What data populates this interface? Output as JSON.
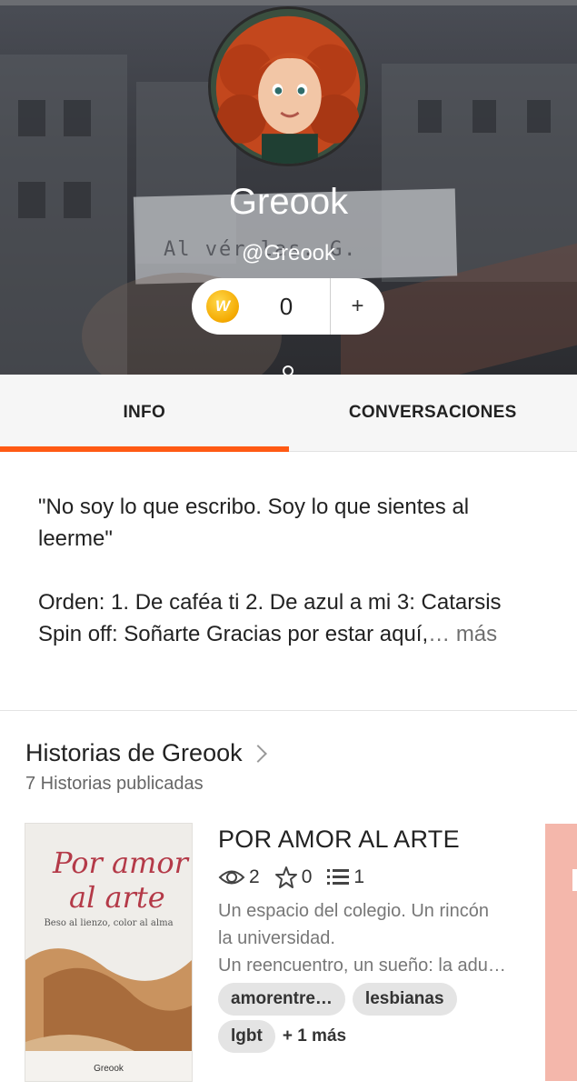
{
  "profile": {
    "display_name": "Greook",
    "handle": "@Greook",
    "background_note_text": "Al vér      las.  G."
  },
  "coins": {
    "icon": "wattpad-coin-icon",
    "icon_letter": "W",
    "count": "0",
    "add_label": "+"
  },
  "tabs": [
    {
      "label": "INFO",
      "active": true
    },
    {
      "label": "CONVERSACIONES",
      "active": false
    }
  ],
  "about": {
    "quote": "\"No soy lo que escribo. Soy lo que sientes al leerme\"",
    "details": "Orden: 1. De caféa ti 2. De azul a mi 3: Catarsis Spin off: Soñarte Gracias por estar aquí,",
    "ellipsis": "…",
    "more_label": "más"
  },
  "stories": {
    "title": "Historias de Greook",
    "count_label": "7 Historias publicadas",
    "items": [
      {
        "title": "POR AMOR AL ARTE",
        "reads": "2",
        "votes": "0",
        "parts": "1",
        "description_lines": [
          "Un espacio del colegio. Un rincón",
          "la universidad.",
          "Un reencuentro, un sueño: la adu…"
        ],
        "tags": [
          "amorentre…",
          "lesbianas",
          "lgbt"
        ],
        "more_tags": "+ 1 más",
        "cover": {
          "title_line1": "Por amor",
          "title_line2": "al arte",
          "subtitle": "Beso al lienzo, color al alma",
          "author": "Greook"
        }
      }
    ]
  },
  "colors": {
    "accent": "#ff5a14",
    "tag_bg": "#e4e4e4"
  }
}
